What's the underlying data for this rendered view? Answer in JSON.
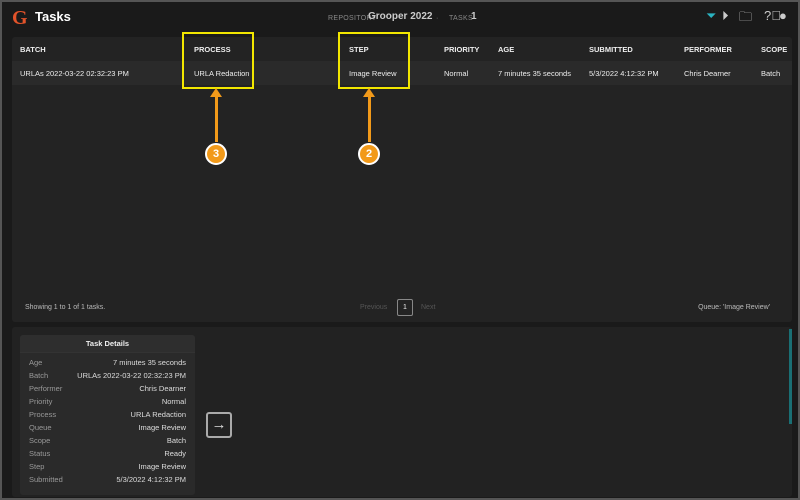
{
  "header": {
    "logo": "G",
    "title": "Tasks",
    "repo_label": "REPOSITORY",
    "repo": "Grooper 2022",
    "tasks_label": "TASKS",
    "tasks_count": "1",
    "filter_color": "#2ab3c0"
  },
  "grid": {
    "columns": [
      "BATCH",
      "PROCESS",
      "STEP",
      "PRIORITY",
      "AGE",
      "SUBMITTED",
      "PERFORMER",
      "SCOPE"
    ],
    "rows": [
      [
        "URLAs 2022-03-22 02:32:23 PM",
        "URLA Redaction",
        "Image Review",
        "Normal",
        "7 minutes 35 seconds",
        "5/3/2022 4:12:32 PM",
        "Chris Dearner",
        "Batch"
      ]
    ],
    "showing": "Showing 1 to 1 of 1 tasks.",
    "prev": "Previous",
    "page": "1",
    "next": "Next",
    "queue": "Queue: 'Image Review'"
  },
  "details": {
    "title": "Task Details",
    "items": [
      {
        "k": "Age",
        "v": "7 minutes 35 seconds"
      },
      {
        "k": "Batch",
        "v": "URLAs 2022-03-22 02:32:23 PM"
      },
      {
        "k": "Performer",
        "v": "Chris Dearner"
      },
      {
        "k": "Priority",
        "v": "Normal"
      },
      {
        "k": "Process",
        "v": "URLA Redaction"
      },
      {
        "k": "Queue",
        "v": "Image Review"
      },
      {
        "k": "Scope",
        "v": "Batch"
      },
      {
        "k": "Status",
        "v": "Ready"
      },
      {
        "k": "Step",
        "v": "Image Review"
      },
      {
        "k": "Submitted",
        "v": "5/3/2022 4:12:32 PM"
      }
    ]
  },
  "annotations": {
    "a3": "3",
    "a2": "2"
  }
}
